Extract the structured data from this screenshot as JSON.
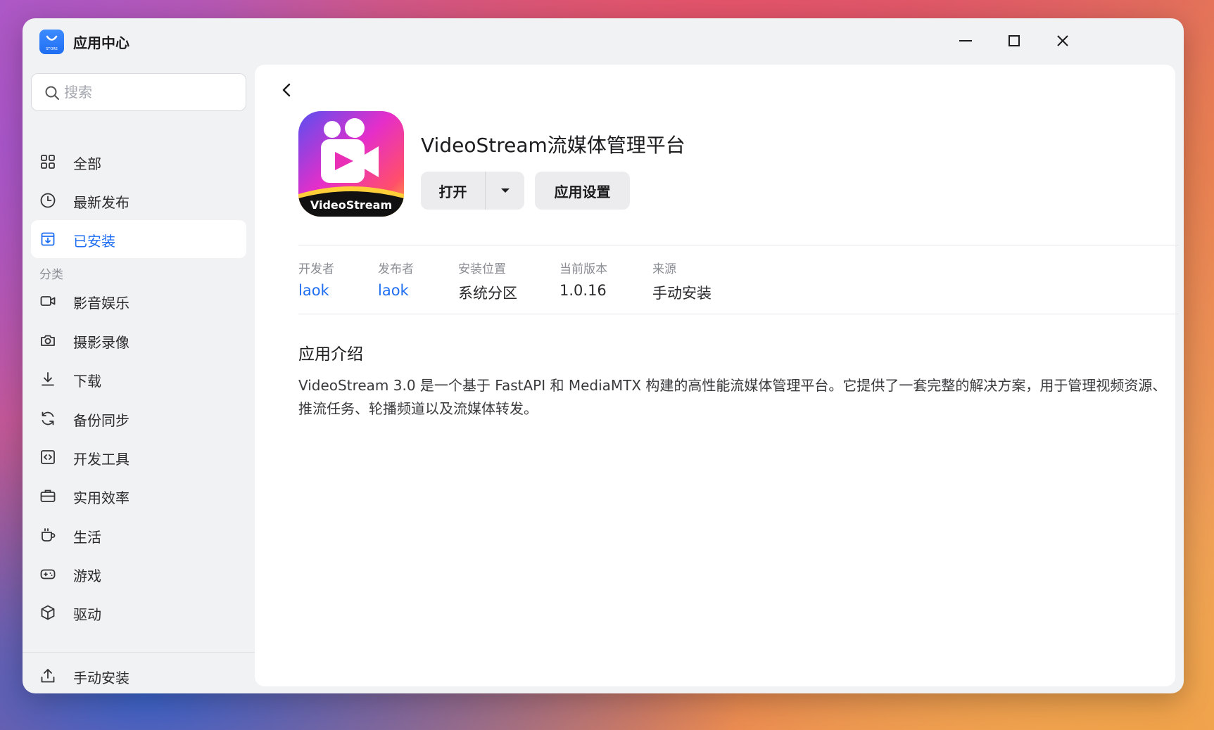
{
  "window": {
    "title": "应用中心",
    "logo_text": "STORE",
    "controls": {
      "minimize": "minimize",
      "maximize": "maximize",
      "close": "close"
    }
  },
  "sidebar": {
    "search_placeholder": "搜索",
    "nav": [
      {
        "label": "全部",
        "icon": "grid-icon"
      },
      {
        "label": "最新发布",
        "icon": "clock-icon"
      },
      {
        "label": "已安装",
        "icon": "installed-icon",
        "active": true
      }
    ],
    "category_title": "分类",
    "categories": [
      {
        "label": "影音娱乐",
        "icon": "video-icon"
      },
      {
        "label": "摄影录像",
        "icon": "camera-icon"
      },
      {
        "label": "下载",
        "icon": "download-icon"
      },
      {
        "label": "备份同步",
        "icon": "sync-icon"
      },
      {
        "label": "开发工具",
        "icon": "code-icon"
      },
      {
        "label": "实用效率",
        "icon": "briefcase-icon"
      },
      {
        "label": "生活",
        "icon": "cup-icon"
      },
      {
        "label": "游戏",
        "icon": "gamepad-icon"
      },
      {
        "label": "驱动",
        "icon": "cube-icon"
      }
    ],
    "manual_install": "手动安装"
  },
  "app": {
    "name": "VideoStream流媒体管理平台",
    "icon_caption": "VideoStream",
    "open_label": "打开",
    "settings_label": "应用设置",
    "meta": [
      {
        "key": "开发者",
        "value": "laok",
        "link": true
      },
      {
        "key": "发布者",
        "value": "laok",
        "link": true
      },
      {
        "key": "安装位置",
        "value": "系统分区"
      },
      {
        "key": "当前版本",
        "value": "1.0.16"
      },
      {
        "key": "来源",
        "value": "手动安装"
      }
    ],
    "intro_title": "应用介绍",
    "intro_text": "VideoStream 3.0 是一个基于 FastAPI 和 MediaMTX 构建的高性能流媒体管理平台。它提供了一套完整的解决方案，用于管理视频资源、推流任务、轮播频道以及流媒体转发。"
  },
  "colors": {
    "accent": "#1f6ef2",
    "window_bg": "#f1f2f4",
    "panel_bg": "#ffffff",
    "button_bg": "#ececee"
  }
}
